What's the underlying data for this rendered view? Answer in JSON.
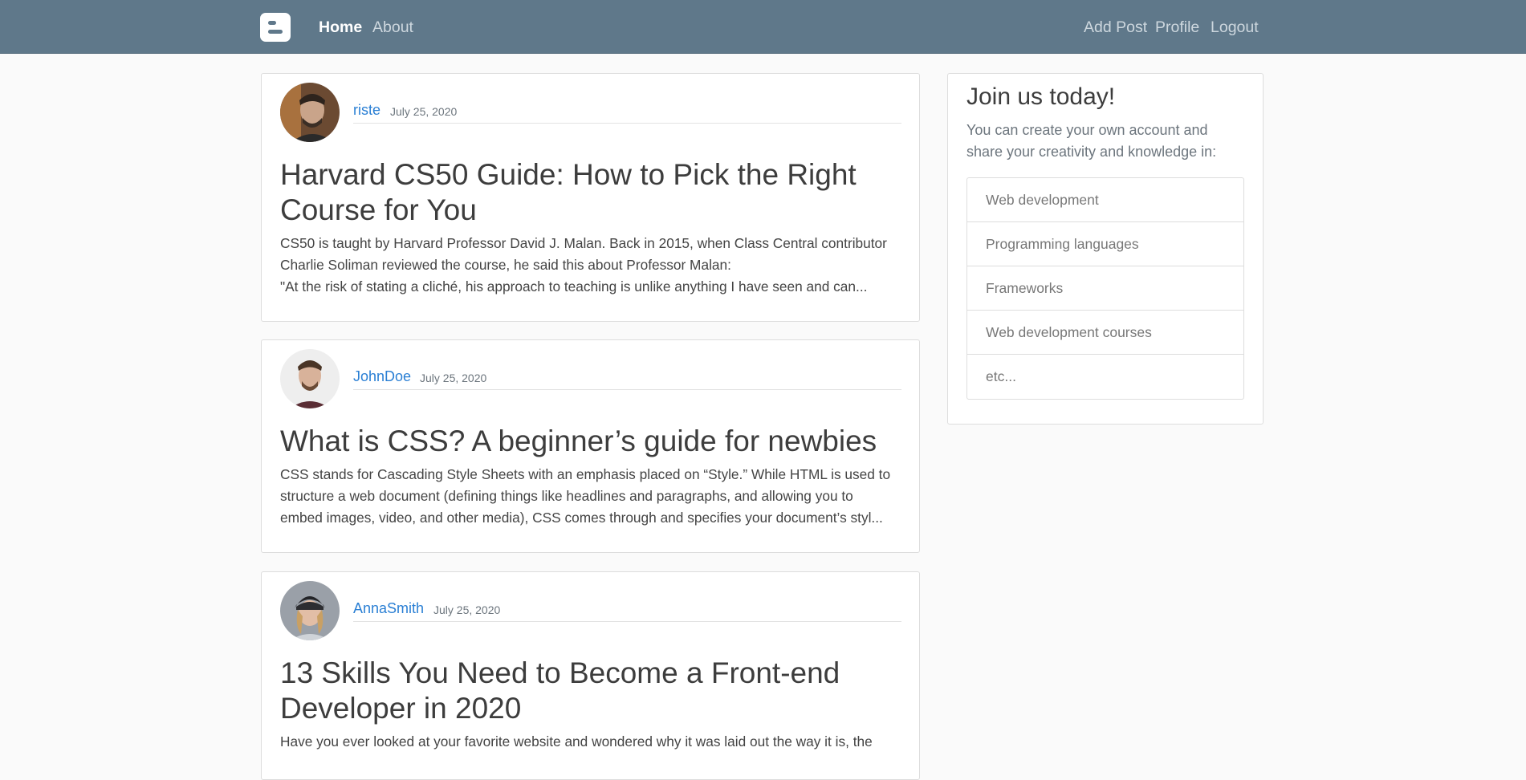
{
  "nav": {
    "brand_icon": "blogger-icon",
    "left": [
      "Home",
      "About"
    ],
    "right": [
      "Add Post",
      "Profile",
      "Logout"
    ]
  },
  "posts": [
    {
      "author": "riste",
      "date": "July 25, 2020",
      "title_lines": [
        "Harvard CS50 Guide: How to Pick the Right",
        "Course for You"
      ],
      "excerpt_lines": [
        "CS50 is taught by Harvard Professor David J. Malan. Back in 2015, when Class Central contributor",
        "Charlie Soliman reviewed the course, he said this about Professor Malan:",
        "\"At the risk of stating a cliché, his approach to teaching is unlike anything I have seen and can..."
      ]
    },
    {
      "author": "JohnDoe",
      "date": "July 25, 2020",
      "title_lines": [
        "What is CSS? A beginner’s guide for newbies"
      ],
      "excerpt_lines": [
        "CSS stands for Cascading Style Sheets with an emphasis placed on “Style.” While HTML is used to",
        "structure a web document (defining things like headlines and paragraphs, and allowing you to",
        "embed images, video, and other media), CSS comes through and specifies your document’s styl..."
      ]
    },
    {
      "author": "AnnaSmith",
      "date": "July 25, 2020",
      "title_lines": [
        "13 Skills You Need to Become a Front-end",
        "Developer in 2020"
      ],
      "excerpt_lines": [
        "Have you ever looked at your favorite website and wondered why it was laid out the way it is, the"
      ]
    }
  ],
  "sidebar": {
    "title": "Join us today!",
    "text": "You can create your own account and share your creativity and knowledge in:",
    "items": [
      "Web development",
      "Programming languages",
      "Frameworks",
      "Web development courses",
      "etc..."
    ]
  },
  "colors": {
    "navbar": "#5f788a",
    "link": "#2a7fd4"
  }
}
